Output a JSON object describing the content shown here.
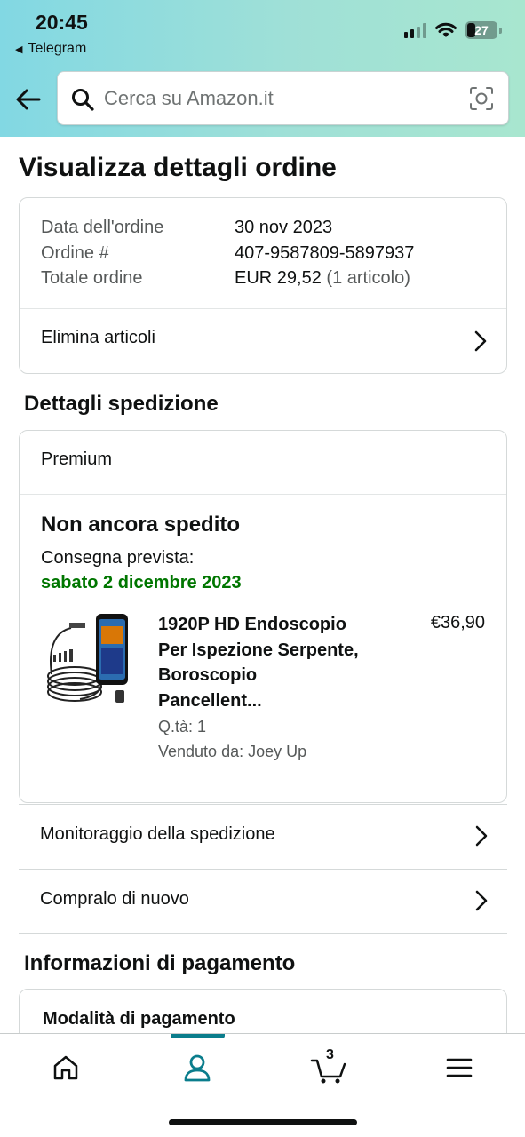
{
  "status_bar": {
    "time": "20:45",
    "back_app": "Telegram",
    "battery": "27"
  },
  "search": {
    "placeholder": "Cerca su Amazon.it"
  },
  "page_title": "Visualizza dettagli ordine",
  "order": {
    "date_label": "Data dell'ordine",
    "date_value": "30 nov 2023",
    "number_label": "Ordine #",
    "number_value": "407-9587809-5897937",
    "total_label": "Totale ordine",
    "total_value": "EUR 29,52",
    "total_items": "(1 articolo)",
    "delete_items": "Elimina articoli"
  },
  "shipping": {
    "section_title": "Dettagli spedizione",
    "service": "Premium",
    "status": "Non ancora spedito",
    "delivery_label": "Consegna prevista:",
    "delivery_date": "sabato 2 dicembre 2023",
    "product": {
      "title_lines": [
        "1920P HD Endoscopio",
        "Per Ispezione Serpente,",
        "Boroscopio",
        "Pancellent..."
      ],
      "price": "€36,90",
      "quantity": "Q.tà: 1",
      "seller": "Venduto da: Joey Up"
    }
  },
  "links": {
    "tracking": "Monitoraggio della spedizione",
    "buy_again": "Compralo di nuovo"
  },
  "payment": {
    "section_title": "Informazioni di pagamento",
    "method_title": "Modalità di pagamento"
  },
  "tabbar": {
    "cart_count": "3",
    "active_tab": "account"
  },
  "colors": {
    "accent": "#0a7d8c",
    "delivery_green": "#007600",
    "header_gradient_start": "#82d8e3",
    "header_gradient_end": "#a8e6cf"
  }
}
